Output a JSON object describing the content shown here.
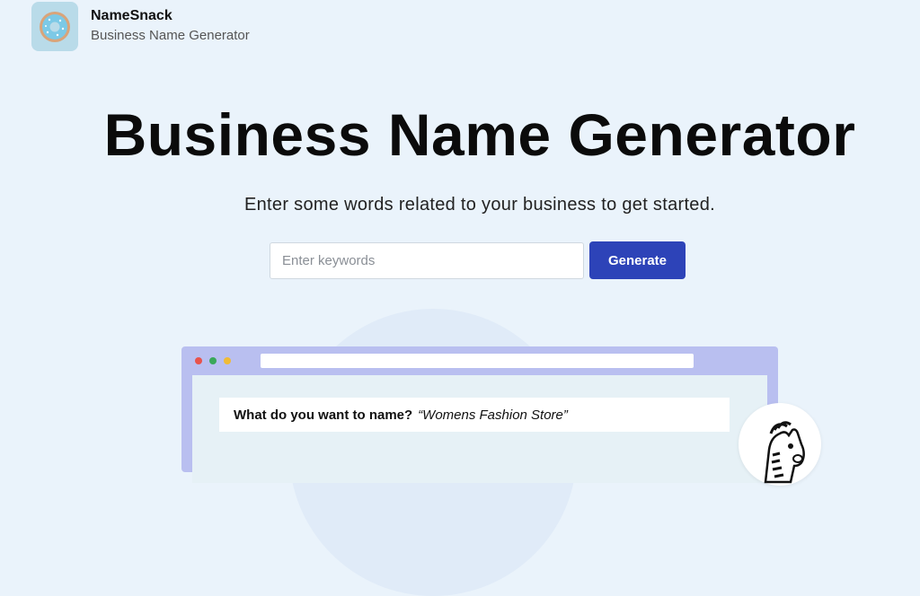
{
  "header": {
    "brand_name": "NameSnack",
    "brand_tagline": "Business Name Generator",
    "logo_icon": "donut-icon"
  },
  "hero": {
    "title": "Business Name Generator",
    "subtitle": "Enter some words related to your business to get started."
  },
  "search": {
    "placeholder": "Enter keywords",
    "value": "",
    "generate_label": "Generate"
  },
  "preview": {
    "prompt_label": "What do you want to name?",
    "prompt_example": "“Womens Fashion Store”",
    "mascot_icon": "zebra-mascot-icon"
  },
  "colors": {
    "background": "#eaf3fb",
    "accent": "#2d43b8",
    "logo_bg": "#b9dbe9",
    "window_frame": "#b9bff0"
  }
}
